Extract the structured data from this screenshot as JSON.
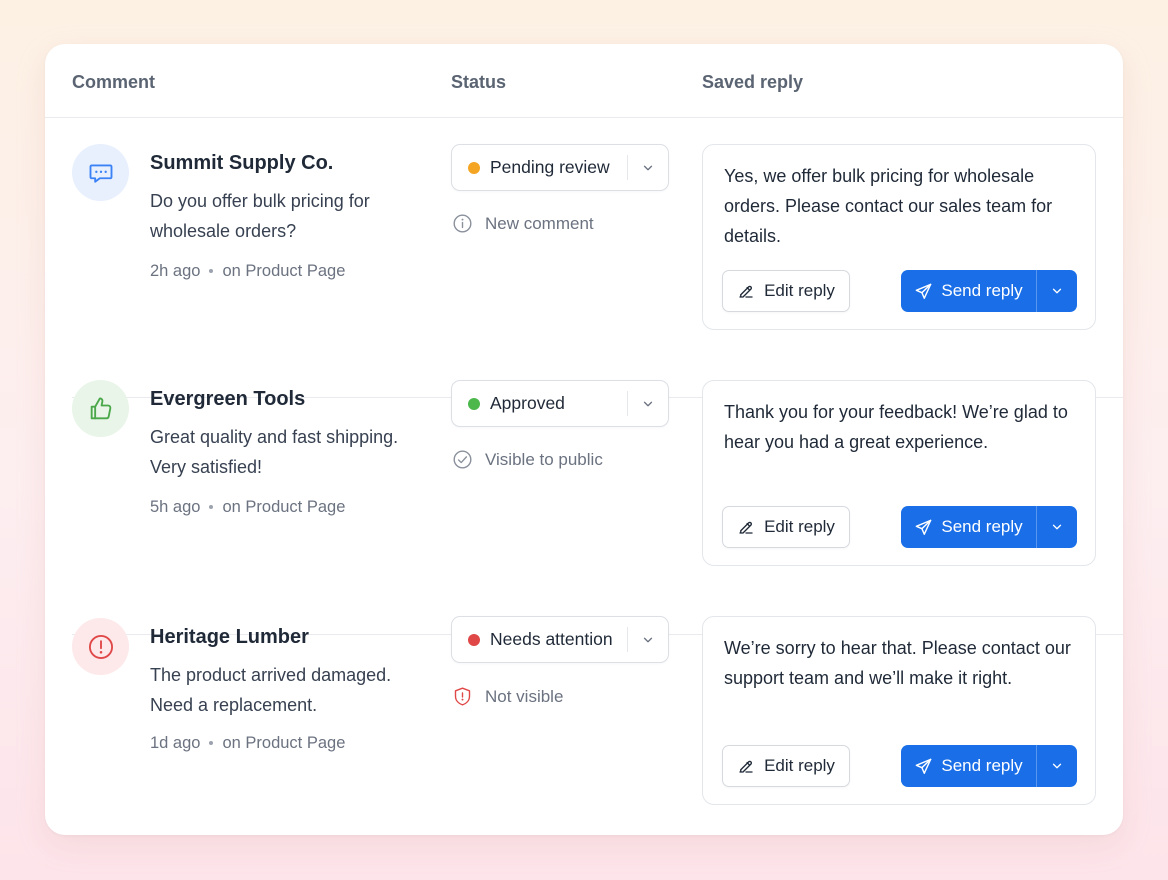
{
  "colors": {
    "accent": "#1a6fe8",
    "pending": "#f5a524",
    "approved": "#4cb84c",
    "attention": "#e04848"
  },
  "columns": {
    "comment": "Comment",
    "status": "Status",
    "saved_reply": "Saved reply"
  },
  "rows": [
    {
      "avatar_icon": "chat-bubble-icon",
      "company": "Summit Supply Co.",
      "comment": "Do you offer bulk pricing for wholesale orders?",
      "time": "2h ago",
      "location": "on Product Page",
      "status": "Pending review",
      "status_color": "#f5a524",
      "status_note_icon": "info-icon",
      "status_note": "New comment",
      "reply": "Yes, we offer bulk pricing for wholesale orders. Please contact our sales team for details.",
      "edit_label": "Edit reply",
      "send_label": "Send reply"
    },
    {
      "avatar_icon": "thumbs-up-icon",
      "company": "Evergreen Tools",
      "comment": "Great quality and fast shipping. Very satisfied!",
      "time": "5h ago",
      "location": "on Product Page",
      "status": "Approved",
      "status_color": "#4cb84c",
      "status_note_icon": "check-circle-icon",
      "status_note": "Visible to public",
      "reply": "Thank you for your feedback! We’re glad to hear you had a great experience.",
      "edit_label": "Edit reply",
      "send_label": "Send reply"
    },
    {
      "avatar_icon": "alert-circle-icon",
      "company": "Heritage Lumber",
      "comment": "The product arrived damaged. Need a replacement.",
      "time": "1d ago",
      "location": "on Product Page",
      "status": "Needs attention",
      "status_color": "#e04848",
      "status_note_icon": "shield-alert-icon",
      "status_note": "Not visible",
      "reply": "We’re sorry to hear that. Please contact our support team and we’ll make it right.",
      "edit_label": "Edit reply",
      "send_label": "Send reply"
    }
  ]
}
